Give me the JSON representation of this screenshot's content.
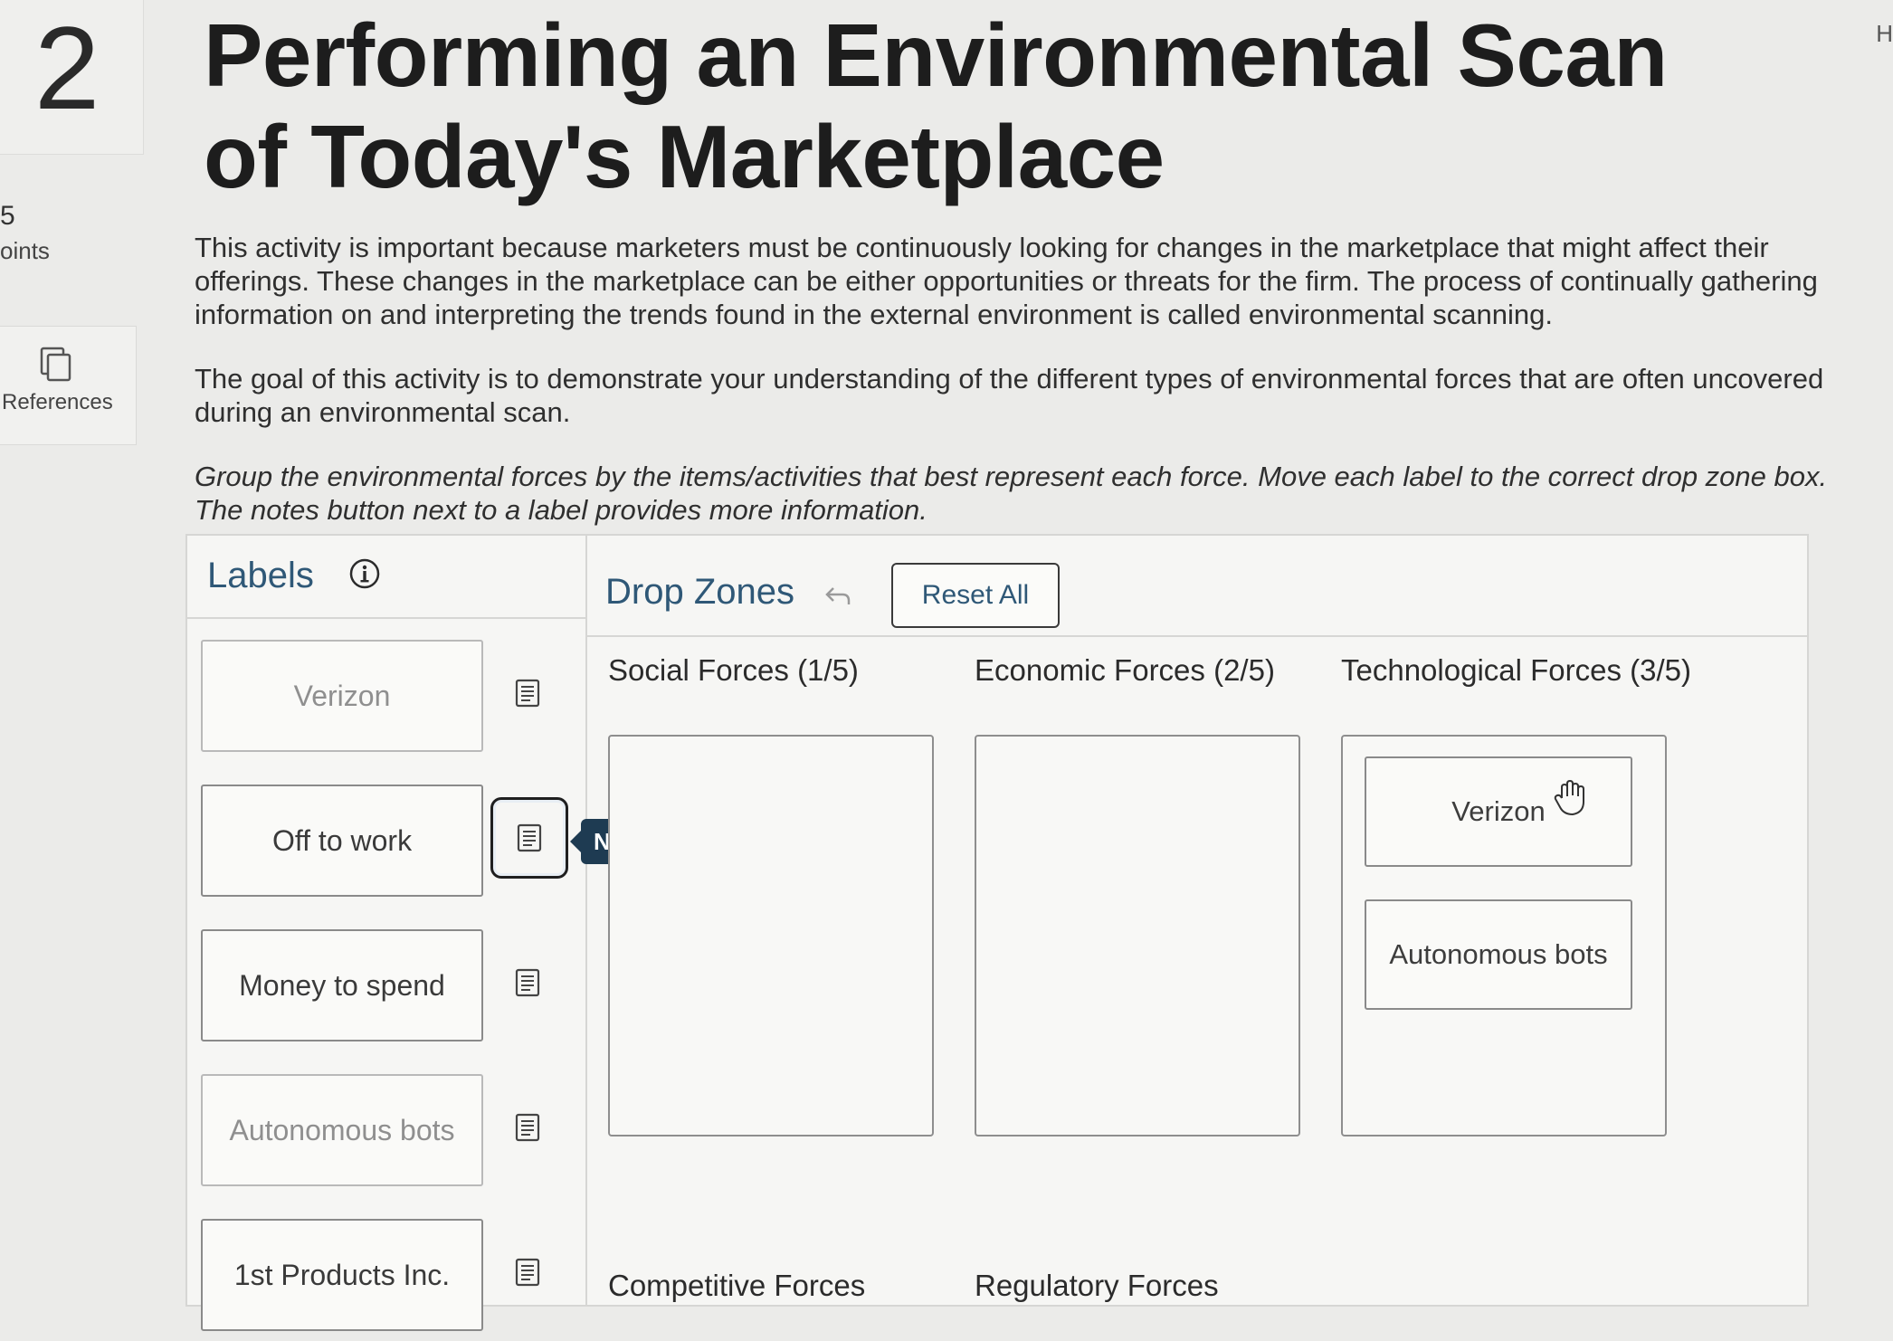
{
  "sidebar": {
    "question_number": "2",
    "points_value": "5",
    "points_label": "oints",
    "references_label": "References",
    "edge_letter": "H"
  },
  "title": "Performing an Environmental Scan of Today's Marketplace",
  "intro": {
    "p1": "This activity is important because marketers must be continuously looking for changes in the marketplace that might affect their offerings. These changes in the marketplace can be either opportunities or threats for the firm. The process of continually gathering information on and interpreting the trends found in the external environment is called environmental scanning.",
    "p2": "The goal of this activity is to demonstrate your understanding of the different types of environmental forces that are often uncovered during an environmental scan.",
    "p3_line1": "Group the environmental forces by the items/activities that best represent each force. Move each label to the correct drop zone box.",
    "p3_line2": "The notes button next to a label provides more information."
  },
  "labels_panel": {
    "title": "Labels",
    "items": [
      {
        "label": "Verizon",
        "state": "used"
      },
      {
        "label": "Off to work",
        "state": "available"
      },
      {
        "label": "Money to spend",
        "state": "available"
      },
      {
        "label": "Autonomous bots",
        "state": "used"
      },
      {
        "label": "1st Products Inc.",
        "state": "available"
      }
    ],
    "notes_tooltip": "Notes"
  },
  "drop_zones": {
    "title": "Drop Zones",
    "reset_label": "Reset All",
    "zones": [
      {
        "title": "Social Forces (1/5)",
        "items": []
      },
      {
        "title": "Economic Forces (2/5)",
        "items": []
      },
      {
        "title": "Technological Forces (3/5)",
        "items": [
          "Verizon",
          "Autonomous bots"
        ]
      },
      {
        "title": "Competitive Forces",
        "items": []
      },
      {
        "title": "Regulatory Forces",
        "items": []
      }
    ]
  }
}
